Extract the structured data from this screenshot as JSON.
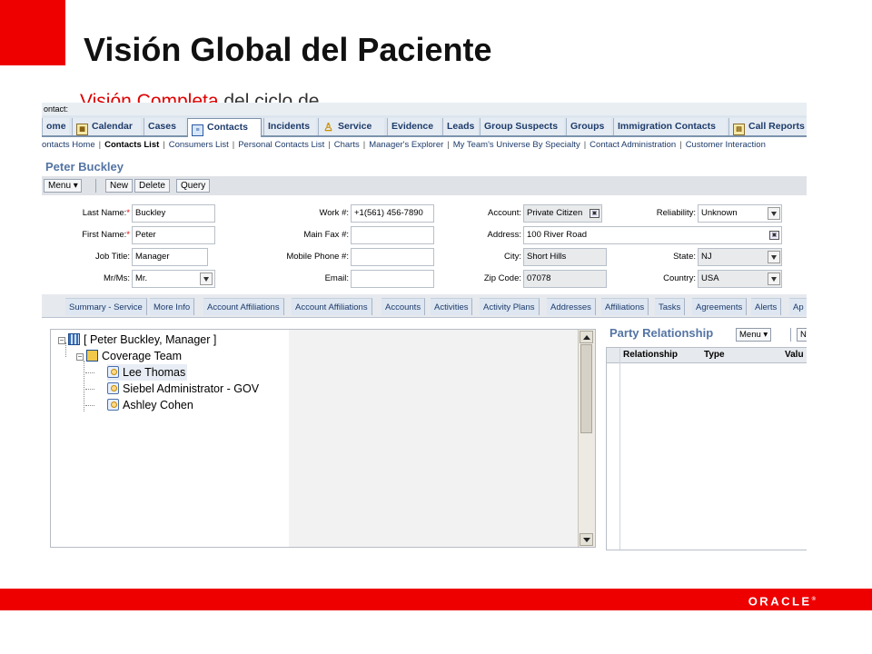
{
  "slide": {
    "title": "Visión Global del Paciente",
    "subtitle_part1": "Visión Completa",
    "subtitle_part2": " del ciclo de... ",
    "footer_logo": "ORACLE"
  },
  "app": {
    "header_text": "ontact:",
    "tabs": [
      "ome",
      "Calendar",
      "Cases",
      "Contacts",
      "Incidents",
      "Service",
      "Evidence",
      "Leads",
      "Group Suspects",
      "Groups",
      "Immigration Contacts",
      "Call Reports"
    ],
    "links": [
      "ontacts Home",
      "Contacts List",
      "Consumers List",
      "Personal Contacts List",
      "Charts",
      "Manager's Explorer",
      "My Team's Universe By Specialty",
      "Contact Administration",
      "Customer Interaction"
    ],
    "record_title": "Peter Buckley",
    "toolbar": {
      "menu": "Menu ▾",
      "new": "New",
      "delete": "Delete",
      "query": "Query"
    }
  },
  "form": {
    "last_name_label": "Last Name:",
    "last_name": "Buckley",
    "first_name_label": "First Name:",
    "first_name": "Peter",
    "job_title_label": "Job Title:",
    "job_title": "Manager",
    "mrms_label": "Mr/Ms:",
    "mrms": "Mr.",
    "required_mark": "*",
    "work_label": "Work #:",
    "work": "+1(561) 456-7890",
    "fax_label": "Main Fax #:",
    "fax": "",
    "mobile_label": "Mobile Phone #:",
    "mobile": "",
    "email_label": "Email:",
    "email": "",
    "account_label": "Account:",
    "account": "Private Citizen",
    "address_label": "Address:",
    "address": "100 River Road",
    "city_label": "City:",
    "city": "Short Hills",
    "zip_label": "Zip Code:",
    "zip": "07078",
    "reliability_label": "Reliability:",
    "reliability": "Unknown",
    "state_label": "State:",
    "state": "NJ",
    "country_label": "Country:",
    "country": "USA"
  },
  "view_tabs": [
    "Summary - Service",
    "More Info",
    "Account Affiliations",
    "Account Affiliations",
    "Accounts",
    "Activities",
    "Activity Plans",
    "Addresses",
    "Affiliations",
    "Tasks",
    "Agreements",
    "Alerts",
    "Ap"
  ],
  "tree": {
    "root": "[ Peter Buckley, Manager ]",
    "team": "Coverage Team",
    "members": [
      "Lee Thomas",
      "Siebel Administrator - GOV",
      "Ashley Cohen"
    ]
  },
  "party": {
    "title": "Party Relationship",
    "menu": "Menu ▾",
    "next": "N",
    "columns": [
      "Relationship",
      "Type",
      "Valu"
    ]
  },
  "colors": {
    "brand_red": "#ee0000",
    "accent_blue": "#5474a3"
  }
}
